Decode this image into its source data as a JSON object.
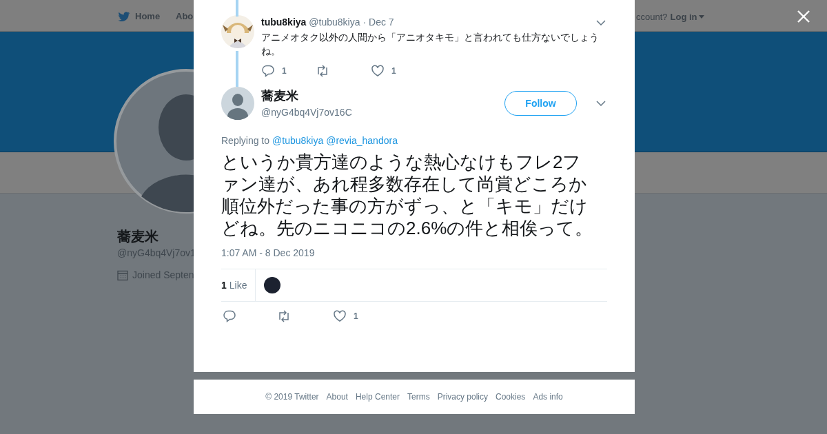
{
  "background": {
    "nav": {
      "items": [
        {
          "label": "Home",
          "kind": "home"
        },
        {
          "label": "Abo",
          "kind": "text"
        }
      ],
      "login_prompt": "ccount?",
      "login": "Log in"
    },
    "profile": {
      "name": "蕎麦米",
      "handle": "@nyG4bq4Vj7ov1",
      "joined": "Joined Septen"
    }
  },
  "modal": {
    "parent_tweet": {
      "name": "tubu8kiya",
      "handle": "@tubu8kiya",
      "date": "· Dec 7",
      "text": "アニメオタク以外の人間から「アニオタキモ」と言われても仕方ないでしょうね。",
      "replies": "1",
      "likes": "1"
    },
    "tweet": {
      "name": "蕎麦米",
      "handle": "@nyG4bq4Vj7ov16C",
      "follow": "Follow",
      "replying_label": "Replying to",
      "mentions": [
        "@tubu8kiya",
        "@revia_handora"
      ],
      "text": "というか貴方達のような熱心なけもフレ2ファン達が、あれ程多数存在して尚賞どころか順位外だった事の方がずっ、と「キモ」だけどね。先のニコニコの2.6%の件と相俟って。",
      "timestamp": "1:07 AM - 8 Dec 2019",
      "likes_count": "1",
      "likes_label": "Like",
      "action_likes": "1"
    },
    "footer": [
      "© 2019 Twitter",
      "About",
      "Help Center",
      "Terms",
      "Privacy policy",
      "Cookies",
      "Ads info"
    ]
  }
}
